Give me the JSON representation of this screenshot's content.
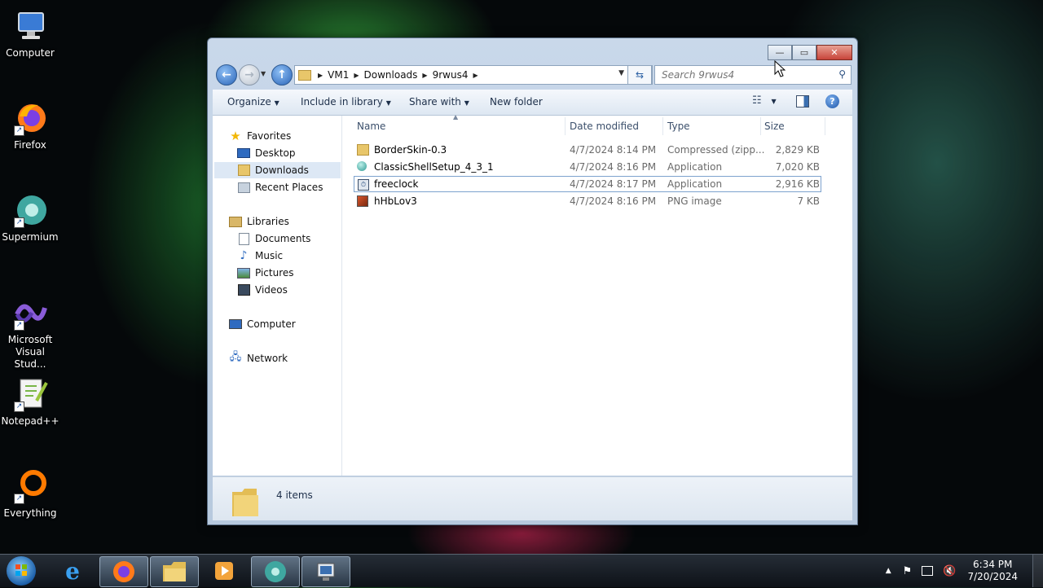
{
  "desktop_icons": [
    {
      "label": "Computer",
      "icon": "computer-icon"
    },
    {
      "label": "Firefox",
      "icon": "firefox-icon"
    },
    {
      "label": "Supermium",
      "icon": "supermium-icon"
    },
    {
      "label": "Microsoft Visual Stud...",
      "icon": "visual-studio-icon"
    },
    {
      "label": "Notepad++",
      "icon": "notepadpp-icon"
    },
    {
      "label": "Everything",
      "icon": "everything-icon"
    }
  ],
  "window": {
    "caption_buttons": {
      "minimize": "—",
      "maximize": "▭",
      "close": "✕"
    },
    "breadcrumb": [
      "VM1",
      "Downloads",
      "9rwus4"
    ],
    "search_placeholder": "Search 9rwus4",
    "toolbar": {
      "organize": "Organize",
      "include_in_library": "Include in library",
      "share_with": "Share with",
      "new_folder": "New folder"
    },
    "nav_pane": {
      "favorites": {
        "label": "Favorites",
        "items": [
          "Desktop",
          "Downloads",
          "Recent Places"
        ]
      },
      "libraries": {
        "label": "Libraries",
        "items": [
          "Documents",
          "Music",
          "Pictures",
          "Videos"
        ]
      },
      "computer": "Computer",
      "network": "Network",
      "selected": "Downloads"
    },
    "columns": [
      "Name",
      "Date modified",
      "Type",
      "Size"
    ],
    "files": [
      {
        "name": "BorderSkin-0.3",
        "date": "4/7/2024 8:14 PM",
        "type": "Compressed (zipp...",
        "size": "2,829 KB",
        "icon": "zip-folder-icon"
      },
      {
        "name": "ClassicShellSetup_4_3_1",
        "date": "4/7/2024 8:16 PM",
        "type": "Application",
        "size": "7,020 KB",
        "icon": "classic-shell-icon"
      },
      {
        "name": "freeclock",
        "date": "4/7/2024 8:17 PM",
        "type": "Application",
        "size": "2,916 KB",
        "icon": "application-icon"
      },
      {
        "name": "hHbLov3",
        "date": "4/7/2024 8:16 PM",
        "type": "PNG image",
        "size": "7 KB",
        "icon": "png-image-icon"
      }
    ],
    "selected_file": "freeclock",
    "status": "4 items"
  },
  "taskbar": {
    "pinned": [
      "start-orb",
      "internet-explorer-icon",
      "firefox-icon",
      "file-explorer-icon",
      "media-player-icon",
      "supermium-icon",
      "control-panel-icon"
    ],
    "clock_time": "6:34 PM",
    "clock_date": "7/20/2024"
  },
  "colors": {
    "selection_border": "#7da2ce",
    "window_frame": "#b7c9de",
    "close_red": "#c7443a"
  }
}
